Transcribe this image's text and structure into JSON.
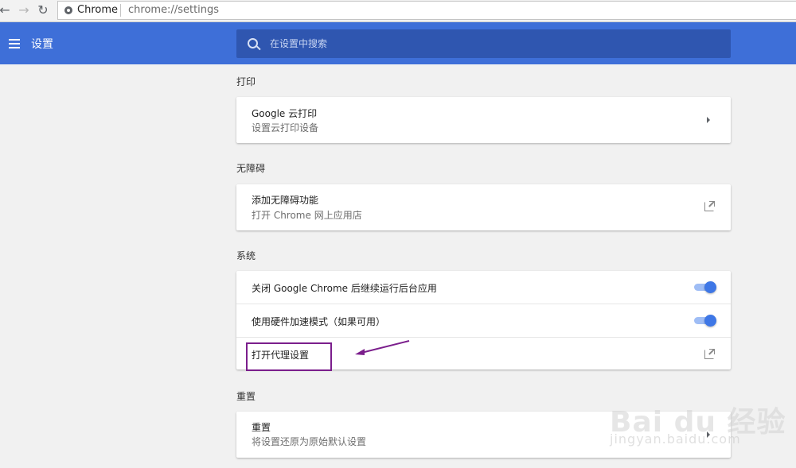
{
  "browser": {
    "site_name": "Chrome",
    "url": "chrome://settings"
  },
  "header": {
    "title": "设置",
    "search_placeholder": "在设置中搜索"
  },
  "sections": {
    "print": {
      "title": "打印",
      "cloud_print": {
        "title": "Google 云打印",
        "subtitle": "设置云打印设备"
      }
    },
    "accessibility": {
      "title": "无障碍",
      "add_features": {
        "title": "添加无障碍功能",
        "subtitle": "打开 Chrome 网上应用店"
      }
    },
    "system": {
      "title": "系统",
      "background_apps": {
        "title": "关闭 Google Chrome 后继续运行后台应用",
        "enabled": true
      },
      "hardware_accel": {
        "title": "使用硬件加速模式（如果可用）",
        "enabled": true
      },
      "proxy": {
        "title": "打开代理设置"
      }
    },
    "reset": {
      "title": "重置",
      "reset_settings": {
        "title": "重置",
        "subtitle": "将设置还原为原始默认设置"
      }
    }
  },
  "watermark": {
    "brand": "Bai du 经验",
    "sub": "jingyan.baidu.com"
  },
  "colors": {
    "header": "#3e6fd8",
    "search": "#2f56b0",
    "toggle": "#3e77e6",
    "annotation": "#7b1e8c"
  }
}
